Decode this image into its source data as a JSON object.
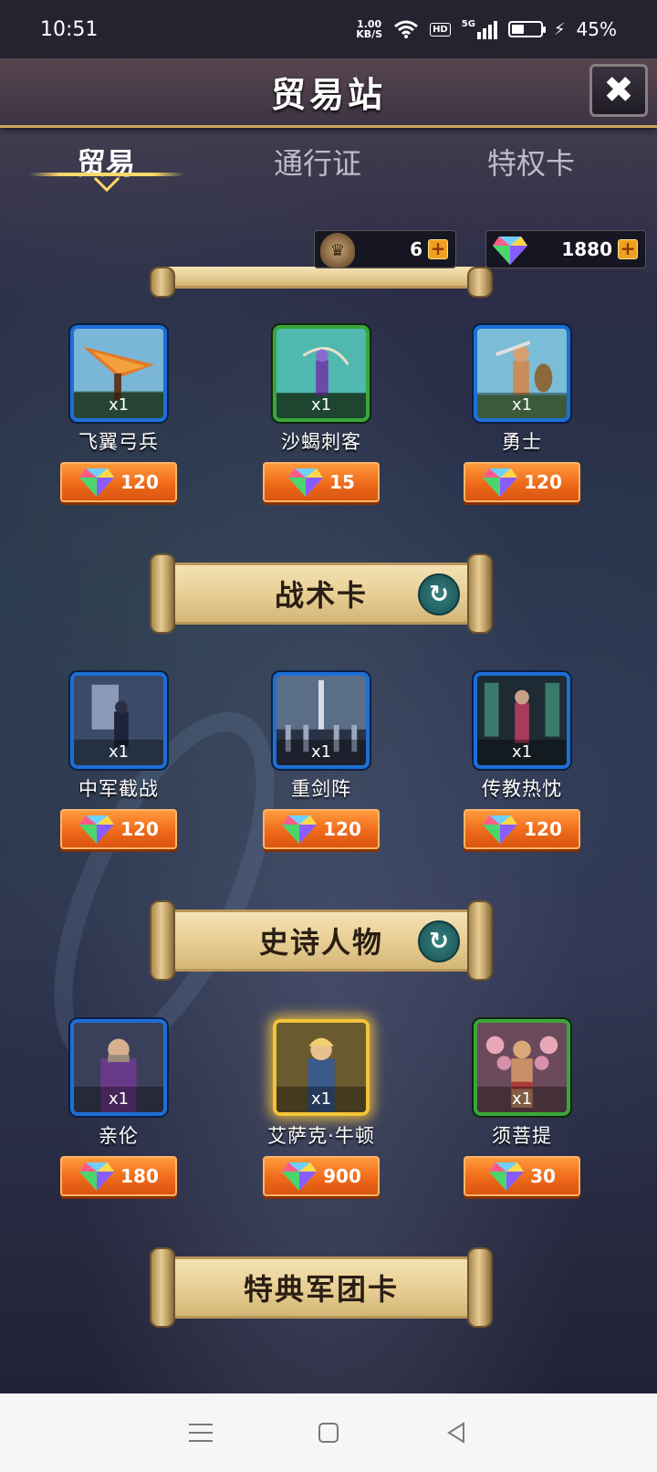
{
  "status_bar": {
    "time": "10:51",
    "net_speed_value": "1.00",
    "net_speed_unit": "KB/S",
    "hd": "HD",
    "signal": "5G",
    "battery": "45%",
    "battery_level": 0.45
  },
  "header": {
    "title": "贸易站",
    "close_label": "✖"
  },
  "tabs": [
    {
      "label": "贸易",
      "active": true
    },
    {
      "label": "通行证",
      "active": false
    },
    {
      "label": "特权卡",
      "active": false
    }
  ],
  "currency": {
    "emblem_amount": "6",
    "gem_amount": "1880",
    "plus": "+"
  },
  "sections": [
    {
      "title": "",
      "items": [
        {
          "name": "飞翼弓兵",
          "qty": "x1",
          "price": "120",
          "rarity": "blue",
          "icon": "winged-archer-icon"
        },
        {
          "name": "沙蝎刺客",
          "qty": "x1",
          "price": "15",
          "rarity": "green",
          "icon": "sand-scorpion-assassin-icon"
        },
        {
          "name": "勇士",
          "qty": "x1",
          "price": "120",
          "rarity": "blue",
          "icon": "warrior-icon"
        }
      ]
    },
    {
      "title": "战术卡",
      "refresh": "↻",
      "items": [
        {
          "name": "中军截战",
          "qty": "x1",
          "price": "120",
          "rarity": "blue",
          "icon": "central-army-card-icon"
        },
        {
          "name": "重剑阵",
          "qty": "x1",
          "price": "120",
          "rarity": "blue",
          "icon": "greatsword-formation-icon"
        },
        {
          "name": "传教热忱",
          "qty": "x1",
          "price": "120",
          "rarity": "blue",
          "icon": "missionary-zeal-icon"
        }
      ]
    },
    {
      "title": "史诗人物",
      "refresh": "↻",
      "items": [
        {
          "name": "亲伦",
          "qty": "x1",
          "price": "180",
          "rarity": "blue",
          "icon": "hero-portrait-icon"
        },
        {
          "name": "艾萨克·牛顿",
          "qty": "x1",
          "price": "900",
          "rarity": "gold",
          "icon": "isaac-newton-portrait-icon"
        },
        {
          "name": "须菩提",
          "qty": "x1",
          "price": "30",
          "rarity": "green",
          "icon": "subhuti-portrait-icon"
        }
      ]
    },
    {
      "title": "特典军团卡"
    }
  ],
  "colors": {
    "accent_gold": "#ffd86a",
    "price_orange": "#ef6a1a",
    "frame_blue": "#1d6fd6",
    "frame_green": "#3aa63a",
    "frame_gold": "#f2c437",
    "refresh_teal": "#1f5a5d"
  }
}
